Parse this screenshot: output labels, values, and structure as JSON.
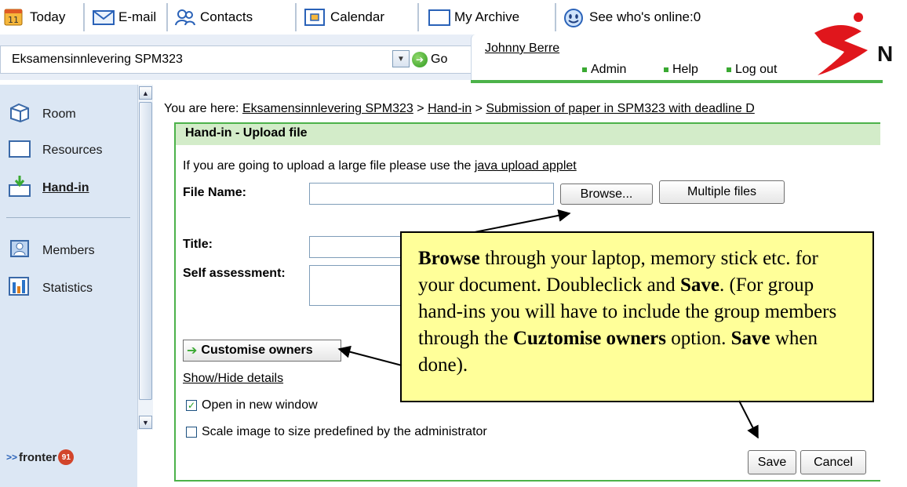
{
  "toolbar": {
    "today": "Today",
    "email": "E-mail",
    "contacts": "Contacts",
    "calendar": "Calendar",
    "archive": "My Archive",
    "online": "See who's online:0",
    "today_badge": "11"
  },
  "roombar": {
    "room_selected": "Eksamensinnlevering SPM323",
    "go": "Go",
    "user": "Johnny Berre",
    "admin": "Admin",
    "help": "Help",
    "logout": "Log out"
  },
  "logo": {
    "letter": "N"
  },
  "sidebar": {
    "items": [
      {
        "label": "Room"
      },
      {
        "label": "Resources"
      },
      {
        "label": "Hand-in"
      },
      {
        "label": "Members"
      },
      {
        "label": "Statistics"
      }
    ],
    "fronter_text": "fronter",
    "fronter_prefix": ">>",
    "fronter_badge": "91"
  },
  "breadcrumb": {
    "prefix": "You are here:",
    "crumb1": "Eksamensinnlevering SPM323",
    "sep": ">",
    "crumb2": "Hand-in",
    "crumb3": "Submission of paper in SPM323 with deadline D"
  },
  "form": {
    "header": "Hand-in - Upload file",
    "info_text": "If you are going to upload a large file please use the",
    "info_link": "java upload applet",
    "file_label": "File Name:",
    "browse": "Browse...",
    "multiple": "Multiple files",
    "title_label": "Title:",
    "self_label": "Self assessment:",
    "customise": "Customise owners",
    "show_hide": "Show/Hide details",
    "open_new": "Open in new window",
    "scale_image": "Scale image to size predefined by the administrator",
    "save": "Save",
    "cancel": "Cancel",
    "open_new_checked": true,
    "scale_image_checked": false
  },
  "callout": {
    "b1": "Browse",
    "t1": " through your laptop, memory stick etc. for your document. Doubleclick and ",
    "b2": "Save",
    "t2": ". (For group hand-ins you will have to include the group members through the ",
    "b3": "Cuztomise owners",
    "t3": " option. ",
    "b4": "Save",
    "t4": " when done)."
  },
  "colors": {
    "accent_green": "#4cb24a",
    "panel_header": "#d3ecc9",
    "sidebar_bg": "#dce7f4",
    "callout_bg": "#ffff99"
  }
}
